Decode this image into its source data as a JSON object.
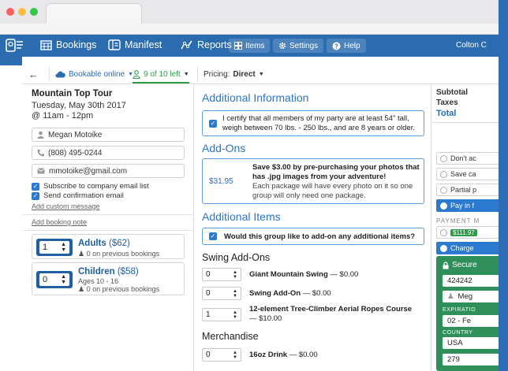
{
  "nav": {
    "bookings": "Bookings",
    "manifest": "Manifest",
    "reports": "Reports",
    "items": "Items",
    "settings": "Settings",
    "help": "Help",
    "user": "Colton C"
  },
  "toolbar": {
    "status": "Bookable online",
    "availability": "9 of 10 left",
    "pricing_label": "Pricing:",
    "pricing_value": "Direct"
  },
  "booking": {
    "tour_name": "Mountain Top Tour",
    "date": "Tuesday, May 30th 2017",
    "time": "@ 11am - 12pm",
    "customer": {
      "name": "Megan Motoike",
      "phone": "(808) 495-0244",
      "email": "mmotoike@gmail.com"
    },
    "subscribe_label": "Subscribe to company email list",
    "confirmation_label": "Send confirmation email",
    "custom_message_link": "Add custom message",
    "booking_note_link": "Add booking note",
    "tickets": [
      {
        "qty": "1",
        "name": "Adults",
        "price": "($62)",
        "sub": "",
        "prev": "0 on previous bookings"
      },
      {
        "qty": "0",
        "name": "Children",
        "price": "($58)",
        "sub": "Ages 10 - 16",
        "prev": "0 on previous bookings"
      }
    ]
  },
  "additional_info": {
    "title": "Additional Information",
    "certify_text": "I certify that all members of my party are at least 54\" tall, weigh between 70 lbs. - 250 lbs., and are 8 years or older."
  },
  "addons": {
    "title": "Add-Ons",
    "price": "$31.95",
    "headline": "Save $3.00 by pre-purchasing your photos that has .jpg images from your adventure!",
    "body": "Each package will have every photo on it so one group will only need one package."
  },
  "additional_items": {
    "title": "Additional Items",
    "question": "Would this group like to add-on any additional items?",
    "groups": [
      {
        "heading": "Swing Add-Ons",
        "items": [
          {
            "qty": "0",
            "name": "Giant Mountain Swing",
            "price": "$0.00"
          },
          {
            "qty": "0",
            "name": "Swing Add-On",
            "price": "$0.00"
          },
          {
            "qty": "1",
            "name": "12-element Tree-Climber Aerial Ropes Course",
            "price": "$10.00"
          }
        ]
      },
      {
        "heading": "Merchandise",
        "items": [
          {
            "qty": "0",
            "name": "16oz Drink",
            "price": "$0.00"
          }
        ]
      }
    ]
  },
  "summary": {
    "subtotal_label": "Subtotal",
    "taxes_label": "Taxes",
    "total_label": "Total",
    "options": [
      "Don't ac",
      "Save ca",
      "Partial p",
      "Pay in f"
    ],
    "payment_method_label": "PAYMENT M",
    "amount": "$111.97",
    "charge_label": "Charge",
    "secure_label": "Secure",
    "card_number": "424242",
    "card_name": "Meg",
    "expiration_label": "EXPIRATIO",
    "expiration_value": "02 - Fe",
    "country_label": "COUNTRY",
    "country_value": "USA",
    "zip_value": "279"
  },
  "colors": {
    "brand_blue": "#2b6cb0",
    "heading_blue": "#2b75c5",
    "secure_green": "#2f8f58",
    "availability_green": "#2e9a4a"
  }
}
